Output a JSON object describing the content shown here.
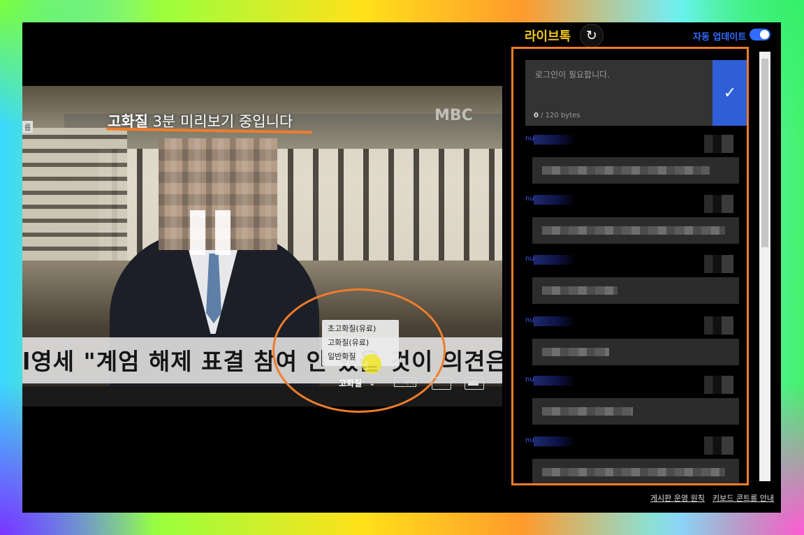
{
  "video": {
    "preview_bold": "고화질",
    "preview_rest": " 3분 미리보기 중입니다",
    "caption": "l영세 \"계엄 해제 표결 참여 안 했을 것이 의견은?",
    "corner_tag": "름",
    "watermark": "MBC"
  },
  "quality_menu": {
    "options": [
      "초고화질(유료)",
      "고화질(유료)",
      "일반화질"
    ]
  },
  "controls": {
    "quality_label": "고화질",
    "subtitle_label": "자막"
  },
  "live_talk": {
    "title": "라이브톡",
    "auto_update_label": "자동 업데이트",
    "auto_update_on": true,
    "input_placeholder": "로그인이 필요합니다.",
    "byte_count": "0",
    "byte_limit": " / 120 bytes",
    "messages": [
      {
        "nick": "nu"
      },
      {
        "nick": "nu"
      },
      {
        "nick": "nu"
      },
      {
        "nick": "nu"
      },
      {
        "nick": "nu"
      },
      {
        "nick": "nu"
      }
    ]
  },
  "footer": {
    "rules_link": "게시판 운영 원칙",
    "keyboard_link": "키보드 콘트롤 안내"
  },
  "colors": {
    "accent_orange": "#f07d2a",
    "title_yellow": "#f3c623",
    "brand_blue": "#2f6cff"
  }
}
